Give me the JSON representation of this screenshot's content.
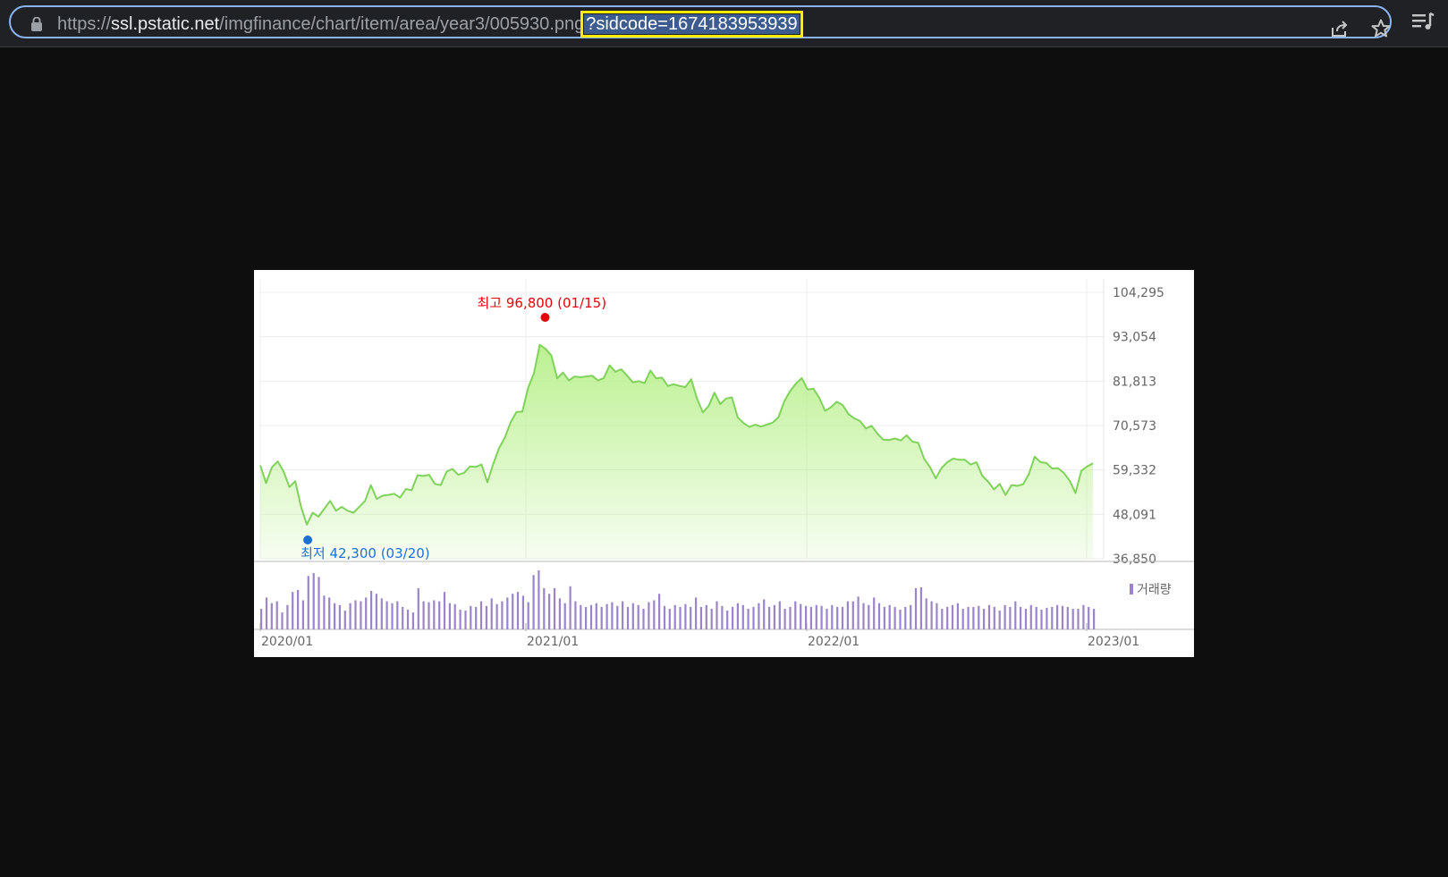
{
  "browser": {
    "url_scheme": "https://",
    "url_host": "ssl.pstatic.net",
    "url_path": "/imgfinance/chart/item/area/year3/005930.png",
    "url_query": "?sidcode=1674183953939",
    "icons": [
      "lock-icon",
      "share-icon",
      "star-icon",
      "reading-list-icon"
    ]
  },
  "chart_data": {
    "type": "area",
    "x_ticks": [
      "2020/01",
      "2021/01",
      "2022/01",
      "2023/01"
    ],
    "y_ticks": [
      "104,295",
      "93,054",
      "81,813",
      "70,573",
      "59,332",
      "48,091",
      "36,850"
    ],
    "ylim": [
      36850,
      104295
    ],
    "high": {
      "label": "최고",
      "value": "96,800",
      "date": "(01/15)"
    },
    "low": {
      "label": "최저",
      "value": "42,300",
      "date": "(03/20)"
    },
    "volume_legend": "거래량",
    "colors": {
      "line": "#7fd35a",
      "fill_top": "#b8f08c",
      "volume": "#9b84c9",
      "high": "#e8000b",
      "low": "#1e6fd9"
    },
    "series": [
      {
        "values": [
          60500,
          56000,
          60000,
          61500,
          59000,
          55000,
          56500,
          50000,
          45500,
          48500,
          47500,
          49500,
          51500,
          49000,
          50000,
          49000,
          48500,
          50000,
          51500,
          55500,
          52000,
          52800,
          53000,
          53300,
          52300,
          54500,
          54200,
          58000,
          57800,
          58100,
          55800,
          55500,
          58900,
          59600,
          58100,
          58600,
          60200,
          60100,
          60700,
          56200,
          60800,
          64800,
          67500,
          71400,
          74000,
          74100,
          80100,
          83800,
          91000,
          90000,
          88300,
          82500,
          84000,
          82000,
          83000,
          82800,
          83000,
          83200,
          82000,
          82600,
          85800,
          84200,
          84800,
          83200,
          81500,
          81800,
          81300,
          84500,
          82500,
          82700,
          80600,
          81000,
          80600,
          80300,
          82300,
          77400,
          73900,
          75500,
          78900,
          76000,
          77400,
          77700,
          72600,
          71200,
          70200,
          70800,
          70300,
          70800,
          71300,
          72700,
          76700,
          79300,
          81200,
          82600,
          79700,
          79900,
          77600,
          74300,
          75200,
          76600,
          75800,
          73500,
          72400,
          71700,
          69800,
          70500,
          68500,
          67000,
          66900,
          67300,
          66800,
          68100,
          66500,
          66200,
          62200,
          60100,
          57200,
          59800,
          61300,
          62200,
          61900,
          61900,
          60700,
          61300,
          57800,
          56400,
          54400,
          55800,
          53000,
          55500,
          55300,
          55700,
          58300,
          62700,
          61300,
          61100,
          59700,
          59800,
          58600,
          56600,
          53500,
          59100,
          60200,
          61000
        ]
      }
    ],
    "volume": [
      22,
      34,
      28,
      30,
      18,
      26,
      40,
      42,
      31,
      57,
      60,
      56,
      36,
      34,
      28,
      26,
      20,
      28,
      31,
      30,
      34,
      41,
      38,
      33,
      30,
      28,
      30,
      24,
      21,
      18,
      44,
      30,
      29,
      31,
      30,
      40,
      28,
      27,
      21,
      20,
      25,
      24,
      30,
      25,
      33,
      27,
      30,
      34,
      38,
      40,
      36,
      29,
      58,
      63,
      44,
      38,
      44,
      33,
      28,
      46,
      30,
      26,
      24,
      26,
      28,
      24,
      27,
      29,
      25,
      30,
      24,
      28,
      26,
      22,
      29,
      31,
      38,
      25,
      22,
      26,
      24,
      27,
      24,
      34,
      24,
      26,
      22,
      30,
      25,
      20,
      24,
      28,
      26,
      22,
      24,
      28,
      32,
      24,
      26,
      30,
      22,
      24,
      30,
      27,
      25,
      24,
      26,
      25,
      22,
      26,
      24,
      24,
      30,
      30,
      35,
      28,
      26,
      34,
      28,
      24,
      26,
      24,
      21,
      24,
      26,
      44,
      45,
      33,
      30,
      28,
      22,
      24,
      26,
      28,
      22,
      24,
      24,
      25,
      22,
      26,
      24,
      20,
      26,
      24,
      30,
      24,
      22,
      26,
      24,
      21,
      23,
      24,
      26,
      25,
      24,
      22,
      22,
      26,
      24,
      22
    ]
  }
}
